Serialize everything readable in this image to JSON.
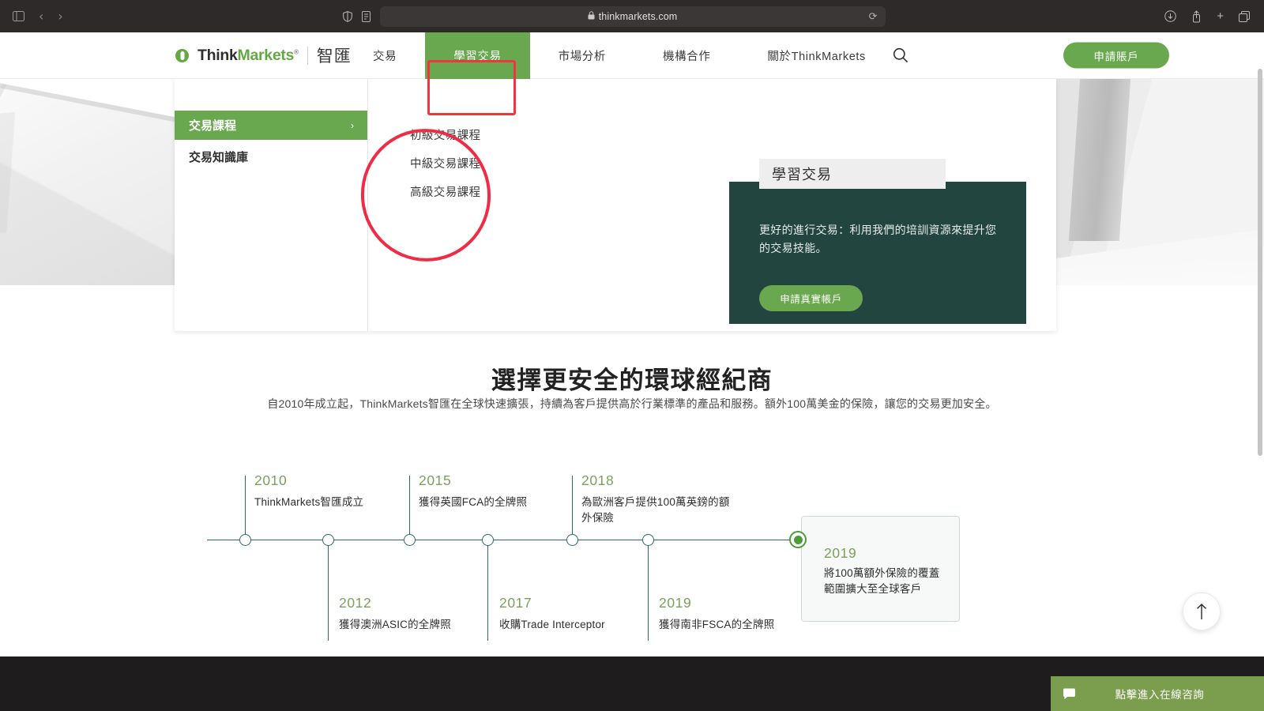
{
  "browser": {
    "url": "thinkmarkets.com",
    "lock_icon": "lock-icon",
    "sidebar_icon": "sidebar-toggle-icon",
    "back_label": "‹",
    "forward_label": "›",
    "shield_icon": "shield-icon",
    "reader_icon": "reader-icon",
    "reload_label": "⟳",
    "downloads_icon": "downloads-icon",
    "share_label": "⇧",
    "newtab_label": "+",
    "tabs_label": "❐"
  },
  "header": {
    "logo": {
      "think": "Think",
      "markets": "Markets",
      "reg": "®",
      "cn": "智匯"
    },
    "nav": [
      {
        "label": "交易",
        "active": false
      },
      {
        "label": "學習交易",
        "active": true
      },
      {
        "label": "市場分析",
        "active": false
      },
      {
        "label": "機構合作",
        "active": false
      },
      {
        "label": "關於ThinkMarkets",
        "active": false
      }
    ],
    "search_icon": "search-icon",
    "cta_label": "申請賬戶"
  },
  "mega_menu": {
    "left_items": [
      {
        "label": "交易課程",
        "active": true,
        "chevron": "›"
      },
      {
        "label": "交易知識庫",
        "active": false,
        "chevron": ""
      }
    ],
    "sub_items": [
      {
        "label": "初級交易課程"
      },
      {
        "label": "中級交易課程"
      },
      {
        "label": "高級交易課程"
      }
    ],
    "promo": {
      "title": "學習交易",
      "text": "更好的進行交易：利用我們的培訓資源來提升您的交易技能。",
      "cta_label": "申請真實帳戶"
    }
  },
  "section": {
    "title": "選擇更安全的環球經紀商",
    "subtitle": "自2010年成立起，ThinkMarkets智匯在全球快速擴張，持續為客戶提供高於行業標準的產品和服務。額外100萬美金的保險，讓您的交易更加安全。"
  },
  "timeline": {
    "events_above": [
      {
        "year": "2010",
        "desc": "ThinkMarkets智匯成立"
      },
      {
        "year": "2015",
        "desc": "獲得英國FCA的全牌照"
      },
      {
        "year": "2018",
        "desc": "為歐洲客戶提供100萬英鎊的額外保險"
      }
    ],
    "events_below": [
      {
        "year": "2012",
        "desc": "獲得澳洲ASIC的全牌照"
      },
      {
        "year": "2017",
        "desc": "收購Trade Interceptor"
      },
      {
        "year": "2019",
        "desc": "獲得南非FSCA的全牌照"
      }
    ],
    "highlight": {
      "year": "2019",
      "desc": "將100萬額外保險的覆蓋範圍擴大至全球客戶"
    }
  },
  "floating": {
    "scroll_top_label": "↑",
    "chat_label": "點擊進入在線咨詢",
    "chat_icon": "chat-bubble-icon"
  },
  "colors": {
    "brand_green": "#6aa84f",
    "dark_teal": "#22453f",
    "timeline_line": "#2d6b6b",
    "year_green": "#7ba05b",
    "annotation_red": "#ef2b45"
  }
}
